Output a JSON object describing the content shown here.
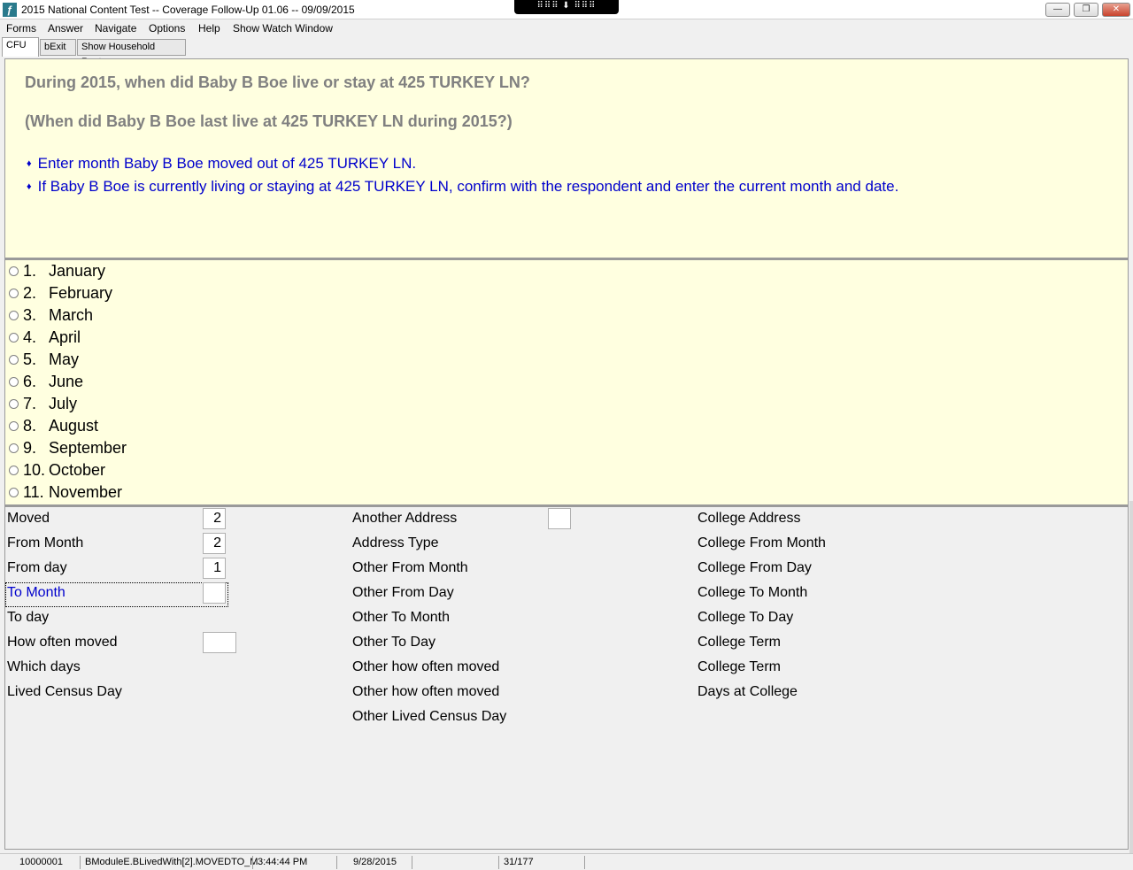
{
  "window": {
    "title": "2015 National Content Test -- Coverage Follow-Up 01.06 -- 09/09/2015",
    "app_icon": "app-logo-icon",
    "remote_bar": "⠿⠿⠿ ⬇ ⠿⠿⠿",
    "controls": {
      "minimize": "—",
      "restore": "❐",
      "close": "✕"
    }
  },
  "menu": [
    "Forms",
    "Answer",
    "Navigate",
    "Options",
    "Help",
    "Show Watch Window"
  ],
  "tabs": [
    "CFU",
    "bExit",
    "Show Household Roster"
  ],
  "question": {
    "text": "During 2015, when did Baby B Boe live or stay at 425 TURKEY LN?",
    "alt_text": "(When did Baby B Boe last live at 425 TURKEY LN during 2015?)",
    "instructions": [
      "Enter month Baby B Boe moved out of 425 TURKEY LN.",
      "If Baby B Boe is currently living or staying at 425 TURKEY LN, confirm with the respondent and enter the current month and date."
    ],
    "bullet": "♦"
  },
  "options": [
    {
      "num": "1.",
      "label": "January"
    },
    {
      "num": "2.",
      "label": "February"
    },
    {
      "num": "3.",
      "label": "March"
    },
    {
      "num": "4.",
      "label": "April"
    },
    {
      "num": "5.",
      "label": "May"
    },
    {
      "num": "6.",
      "label": "June"
    },
    {
      "num": "7.",
      "label": "July"
    },
    {
      "num": "8.",
      "label": "August"
    },
    {
      "num": "9.",
      "label": "September"
    },
    {
      "num": "10.",
      "label": "October"
    },
    {
      "num": "11.",
      "label": "November"
    }
  ],
  "fields": {
    "col1": [
      {
        "label": "Moved",
        "value": "2"
      },
      {
        "label": "From Month",
        "value": "2"
      },
      {
        "label": "From day",
        "value": "1"
      },
      {
        "label": "To Month",
        "value": ""
      },
      {
        "label": "To day"
      },
      {
        "label": "How often moved",
        "value": ""
      },
      {
        "label": "Which days"
      },
      {
        "label": "Lived Census Day"
      }
    ],
    "col2": [
      {
        "label": "Another Address",
        "value": ""
      },
      {
        "label": "Address Type"
      },
      {
        "label": "Other From Month"
      },
      {
        "label": "Other From Day"
      },
      {
        "label": "Other To Month"
      },
      {
        "label": "Other To Day"
      },
      {
        "label": "Other how often moved"
      },
      {
        "label": "Other how often moved"
      },
      {
        "label": "Other Lived Census Day"
      }
    ],
    "col3": [
      {
        "label": "College Address"
      },
      {
        "label": "College From Month"
      },
      {
        "label": "College From Day"
      },
      {
        "label": "College To Month"
      },
      {
        "label": "College To Day"
      },
      {
        "label": "College Term"
      },
      {
        "label": "College Term"
      },
      {
        "label": "Days at College"
      }
    ]
  },
  "status": {
    "case_id": "10000001",
    "field_path": "BModuleE.BLivedWith[2].MOVEDTO_M",
    "time": "3:44:44 PM",
    "date": "9/28/2015",
    "page": "31/177"
  }
}
